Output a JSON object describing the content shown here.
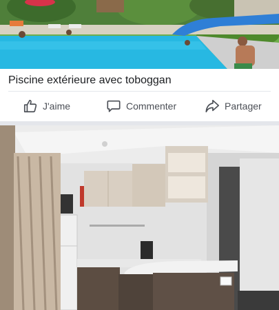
{
  "post": {
    "caption": "Piscine extérieure avec toboggan"
  },
  "actions": {
    "like_label": "J'aime",
    "comment_label": "Commenter",
    "share_label": "Partager"
  },
  "icons": {
    "like": "thumbs-up-icon",
    "comment": "speech-bubble-icon",
    "share": "share-arrow-icon"
  },
  "colors": {
    "text": "#1c1e21",
    "action_text": "#4b4f56",
    "separator": "#e4e6eb"
  }
}
